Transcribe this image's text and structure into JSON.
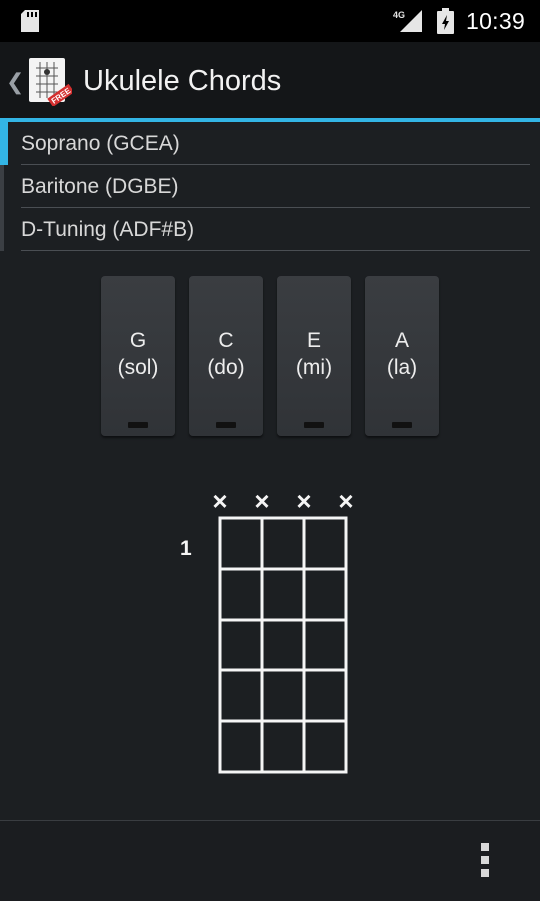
{
  "status_bar": {
    "network": "4G",
    "time": "10:39"
  },
  "action_bar": {
    "title": "Ukulele Chords",
    "icon_badge": "FREE",
    "accent_color": "#33b5e5"
  },
  "tunings": [
    {
      "label": "Soprano (GCEA)",
      "selected": true
    },
    {
      "label": "Baritone (DGBE)",
      "selected": false
    },
    {
      "label": "D-Tuning (ADF#B)",
      "selected": false
    }
  ],
  "notes": [
    {
      "letter": "G",
      "solfege": "(sol)"
    },
    {
      "letter": "C",
      "solfege": "(do)"
    },
    {
      "letter": "E",
      "solfege": "(mi)"
    },
    {
      "letter": "A",
      "solfege": "(la)"
    }
  ],
  "chord": {
    "start_fret": "1",
    "string_marks": [
      "×",
      "×",
      "×",
      "×"
    ],
    "frets_shown": 5,
    "strings": 4
  },
  "icons": {
    "sd_card": "sd-card-icon",
    "signal": "signal-icon",
    "battery": "battery-icon",
    "overflow": "overflow-menu-icon",
    "up": "chevron-left-icon"
  }
}
